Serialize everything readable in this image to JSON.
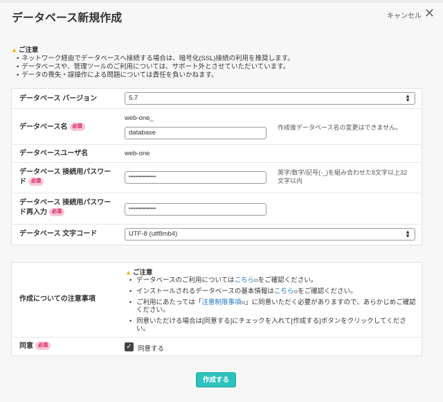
{
  "header": {
    "title": "データベース新規作成",
    "cancel_label": "キャンセル",
    "close_icon": "close-icon"
  },
  "notice": {
    "heading": "ご注意",
    "items": [
      "ネットワーク経由でデータベースへ接続する場合は、暗号化(SSL)接続の利用を推奨します。",
      "データベースや、管理ツールのご利用については、サポート外とさせていただいています。",
      "データの喪失・誤操作による問題については責任を負いかねます。"
    ]
  },
  "form": {
    "required_badge": "必須",
    "version": {
      "label": "データベース バージョン",
      "value": "5.7"
    },
    "db_name": {
      "label": "データベース名",
      "prefix": "web-one_",
      "value": "database",
      "hint": "作成後データベース名の変更はできません。"
    },
    "db_user": {
      "label": "データベースユーザ名",
      "value": "web-one"
    },
    "password": {
      "label_line1": "データベース 接続用パスワー",
      "label_line2": "ド",
      "value": "••••••••••••••••",
      "hint_line1": "英字/数字/記号(-_)を組み合わせた8文字以上32",
      "hint_line2": "文字以内"
    },
    "password_confirm": {
      "label_line1": "データベース 接続用パスワー",
      "label_line2": "ド再入力",
      "value": "••••••••••••••••"
    },
    "charset": {
      "label": "データベース 文字コード",
      "value": "UTF-8 (utf8mb4)"
    }
  },
  "caution": {
    "label": "作成についての注意事項",
    "heading": "ご注意",
    "item1_pre": "データベースのご利用については",
    "item1_link": "こちら",
    "item1_post": "をご確認ください。",
    "item2_pre": "インストールされるデータベースの基本情報は",
    "item2_link": "こちら",
    "item2_post": "をご確認ください。",
    "item3_pre": "ご利用にあたっては「",
    "item3_link": "注意制限事項",
    "item3_post": "」に同意いただく必要がありますので、あらかじめご確認ください。",
    "item4": "同意いただける場合は[同意する]にチェックを入れて[作成する]ボタンをクリックしてください。"
  },
  "agree": {
    "label": "同意",
    "checkbox_label": "同意する",
    "checked": true
  },
  "submit_label": "作成する",
  "colors": {
    "accent": "#2ec2bd",
    "required_bg": "#f7c6d3",
    "required_text": "#d4145a",
    "link": "#1a73c7",
    "warning": "#e8b400"
  }
}
